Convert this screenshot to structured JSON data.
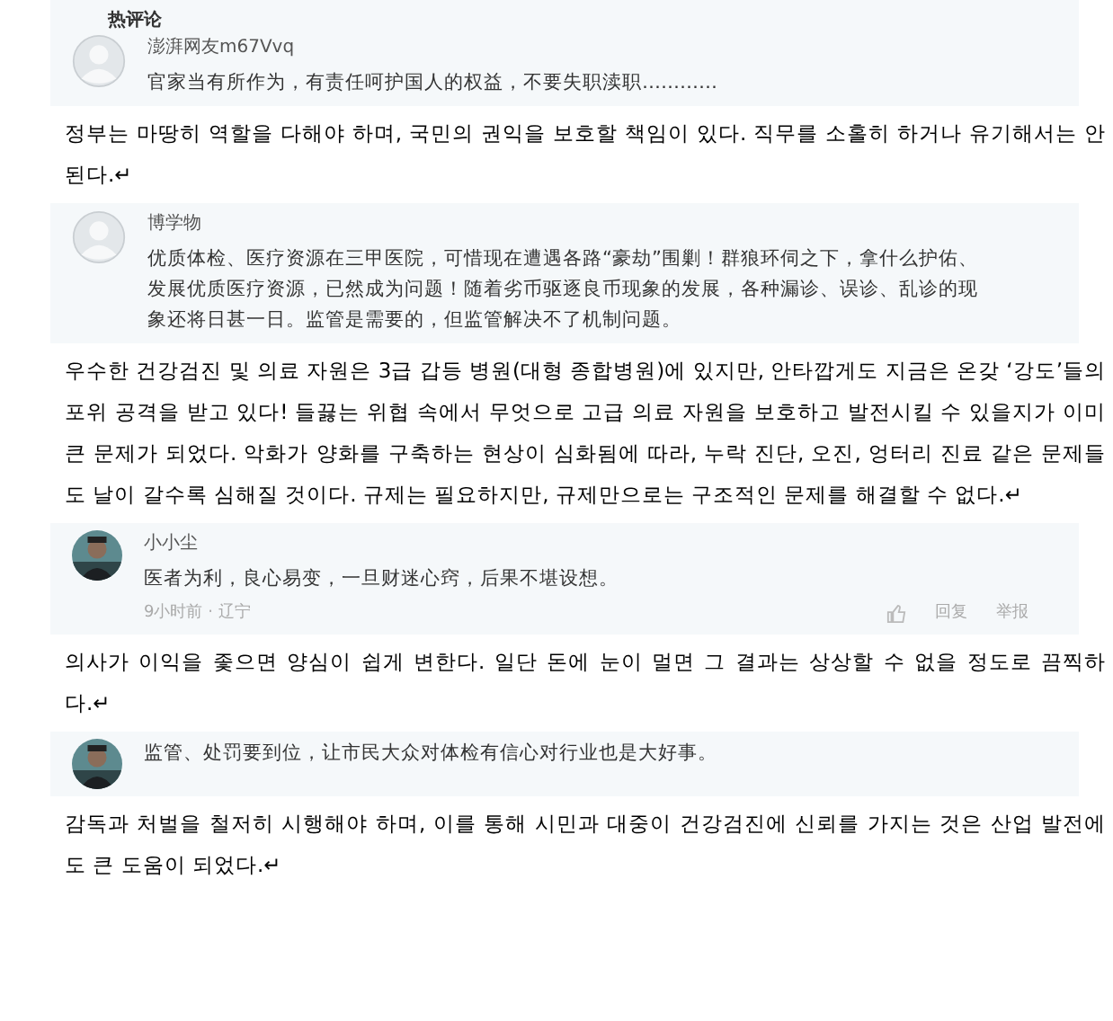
{
  "blocks": [
    {
      "kind": "comment",
      "heading": "热评论",
      "avatar": {
        "kind": "default"
      },
      "user": "澎湃网友m67Vvq",
      "text": "官家当有所作为，有责任呵护国人的权益，不要失职渎职…………"
    },
    {
      "kind": "translation",
      "text": "정부는 마땅히 역할을 다해야 하며, 국민의 권익을 보호할 책임이 있다. 직무를 소홀히 하거나 유기해서는 안 된다.↵"
    },
    {
      "kind": "comment",
      "avatar": {
        "kind": "default"
      },
      "user": "博学物",
      "text": "优质体检、医疗资源在三甲医院，可惜现在遭遇各路“豪劫”围剿！群狼环伺之下，拿什么护佑、发展优质医疗资源，已然成为问题！随着劣币驱逐良币现象的发展，各种漏诊、误诊、乱诊的现象还将日甚一日。监管是需要的，但监管解决不了机制问题。"
    },
    {
      "kind": "translation",
      "text": "우수한 건강검진 및 의료 자원은 3급 갑등 병원(대형 종합병원)에 있지만, 안타깝게도 지금은 온갖 ‘강도’들의 포위 공격을 받고 있다! 들끓는 위협 속에서 무엇으로 고급 의료 자원을 보호하고 발전시킬 수 있을지가 이미 큰 문제가 되었다. 악화가 양화를 구축하는 현상이 심화됨에 따라, 누락 진단, 오진, 엉터리 진료 같은 문제들도 날이 갈수록 심해질 것이다. 규제는 필요하지만, 규제만으로는 구조적인 문제를 해결할 수 없다.↵"
    },
    {
      "kind": "comment",
      "user": "小小尘",
      "text": "医者为利，良心易变，一旦财迷心窍，后果不堪设想。",
      "meta": "9小时前 · 辽宁",
      "actions": [
        "回复",
        "举报"
      ]
    },
    {
      "kind": "translation",
      "text": "의사가 이익을 좇으면 양심이 쉽게 변한다. 일단 돈에 눈이 멀면 그 결과는 상상할 수 없을 정도로 끔찍하다.↵"
    },
    {
      "kind": "comment",
      "text": "监管、处罚要到位，让市民大众对体检有信心对行业也是大好事。"
    },
    {
      "kind": "translation",
      "text": "감독과 처벌을 철저히 시행해야 하며, 이를 통해 시민과 대중이 건강검진에 신뢰를 가지는 것은 산업 발전에도 큰 도움이 되었다.↵"
    }
  ]
}
